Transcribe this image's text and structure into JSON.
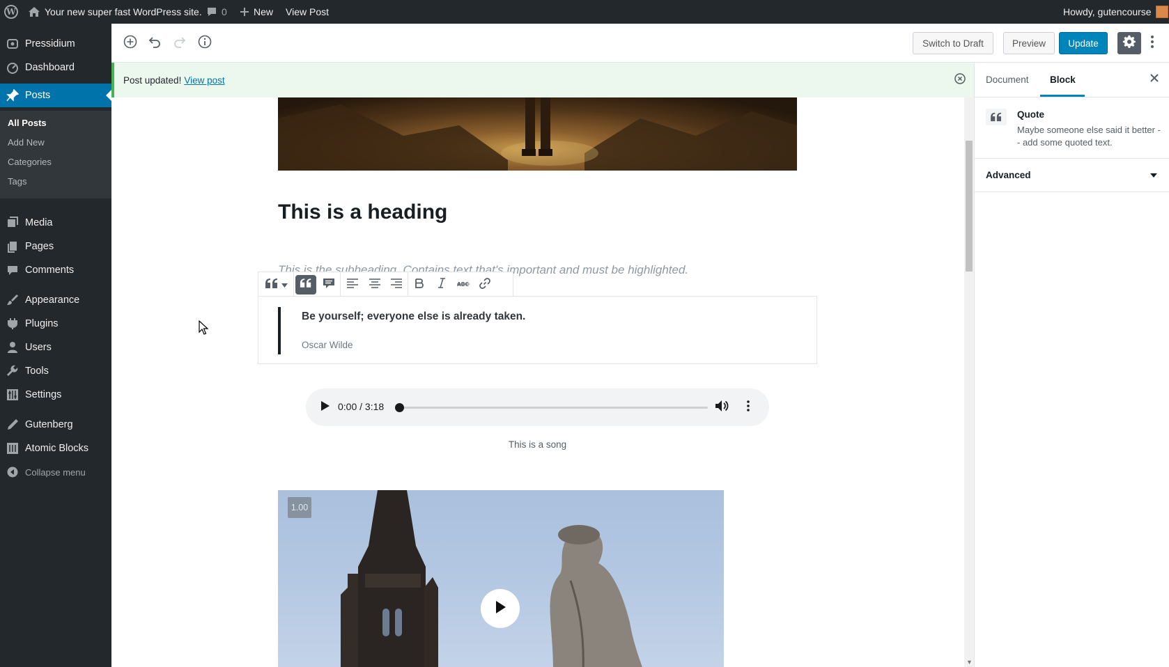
{
  "adminbar": {
    "site_name": "Your new super fast WordPress site.",
    "comments_count": "0",
    "new_label": "New",
    "view_post_label": "View Post",
    "howdy": "Howdy, gutencourse"
  },
  "menu": {
    "brand": "Pressidium",
    "dashboard": "Dashboard",
    "posts": "Posts",
    "submenu": [
      "All Posts",
      "Add New",
      "Categories",
      "Tags"
    ],
    "media": "Media",
    "pages": "Pages",
    "comments": "Comments",
    "appearance": "Appearance",
    "plugins": "Plugins",
    "users": "Users",
    "tools": "Tools",
    "settings": "Settings",
    "gutenberg": "Gutenberg",
    "atomic_blocks": "Atomic Blocks",
    "collapse": "Collapse menu"
  },
  "header": {
    "switch_to_draft": "Switch to Draft",
    "preview": "Preview",
    "update": "Update"
  },
  "notice": {
    "text": "Post updated!",
    "link": "View post"
  },
  "post": {
    "heading": "This is a heading",
    "subheading": "This is the subheading. Contains text that's important and must be highlighted.",
    "quote_text": "Be yourself; everyone else is already taken.",
    "quote_cite": "Oscar Wilde",
    "audio_time": "0:00 / 3:18",
    "audio_caption": "This is a song",
    "video_speed": "1.00"
  },
  "sidebar": {
    "tab_document": "Document",
    "tab_block": "Block",
    "block_title": "Quote",
    "block_description": "Maybe someone else said it better -- add some quoted text.",
    "advanced": "Advanced"
  },
  "colors": {
    "admin_dark": "#23282d",
    "accent_blue": "#0073aa",
    "primary_button": "#0085ba",
    "notice_green": "#46b450"
  }
}
